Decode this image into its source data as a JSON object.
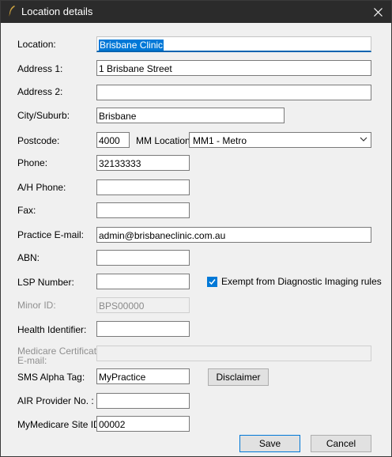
{
  "window": {
    "title": "Location details",
    "app_icon": "quill-icon",
    "close_icon": "close-icon"
  },
  "fields": {
    "location": {
      "label": "Location:",
      "value": "Brisbane Clinic"
    },
    "address1": {
      "label": "Address 1:",
      "value": "1 Brisbane Street"
    },
    "address2": {
      "label": "Address 2:",
      "value": ""
    },
    "city": {
      "label": "City/Suburb:",
      "value": "Brisbane"
    },
    "postcode": {
      "label": "Postcode:",
      "value": "4000"
    },
    "mm_location": {
      "label": "MM Location:",
      "value": "MM1 - Metro"
    },
    "phone": {
      "label": "Phone:",
      "value": "32133333"
    },
    "ah_phone": {
      "label": "A/H Phone:",
      "value": ""
    },
    "fax": {
      "label": "Fax:",
      "value": ""
    },
    "practice_email": {
      "label": "Practice E-mail:",
      "value": "admin@brisbaneclinic.com.au"
    },
    "abn": {
      "label": "ABN:",
      "value": ""
    },
    "lsp_number": {
      "label": "LSP Number:",
      "value": ""
    },
    "minor_id": {
      "label": "Minor ID:",
      "value": "BPS00000"
    },
    "health_identifier": {
      "label": "Health Identifier:",
      "value": ""
    },
    "medicare_cert_email": {
      "label_line1": "Medicare Certificate",
      "label_line2": "E-mail:",
      "value": ""
    },
    "sms_alpha_tag": {
      "label": "SMS Alpha Tag:",
      "value": "MyPractice"
    },
    "air_provider": {
      "label": "AIR Provider No. :",
      "value": ""
    },
    "mymedicare_site_id": {
      "label": "MyMedicare Site ID:",
      "value": "00002"
    }
  },
  "exempt_checkbox": {
    "label": "Exempt from Diagnostic Imaging rules",
    "checked": true
  },
  "buttons": {
    "disclaimer": "Disclaimer",
    "save": "Save",
    "cancel": "Cancel"
  },
  "colors": {
    "titlebar": "#2b2b2b",
    "accent": "#0078d7",
    "dialog_bg": "#f0f0f0"
  }
}
